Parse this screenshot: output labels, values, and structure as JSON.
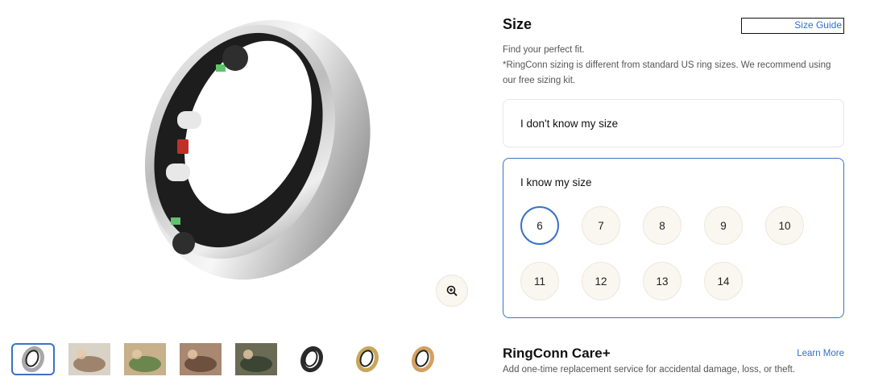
{
  "gallery": {
    "main_image": "silver smart ring product photo",
    "zoom_icon": "zoom-in-icon",
    "thumbnails": [
      {
        "name": "thumb-silver-ring",
        "kind": "ring",
        "color": "#a8a8a8",
        "selected": true
      },
      {
        "name": "thumb-hand-photo",
        "kind": "photo",
        "selected": false
      },
      {
        "name": "thumb-plant-photo",
        "kind": "photo",
        "selected": false
      },
      {
        "name": "thumb-hands-photo",
        "kind": "photo",
        "selected": false
      },
      {
        "name": "thumb-outdoor-photo",
        "kind": "photo",
        "selected": false
      },
      {
        "name": "thumb-black-ring",
        "kind": "ring",
        "color": "#2a2a2a",
        "selected": false
      },
      {
        "name": "thumb-gold-ring",
        "kind": "ring",
        "color": "#c8a75a",
        "selected": false
      },
      {
        "name": "thumb-rose-gold-ring",
        "kind": "ring",
        "color": "#d2a062",
        "selected": false
      }
    ]
  },
  "size": {
    "title": "Size",
    "guide_label": "Size Guide",
    "desc_line1": "Find your perfect fit.",
    "desc_line2": "*RingConn sizing is different from standard US ring sizes. We recommend using our free sizing kit.",
    "option_unknown": "I don't know my size",
    "option_known": "I know my size",
    "sizes": [
      "6",
      "7",
      "8",
      "9",
      "10",
      "11",
      "12",
      "13",
      "14"
    ],
    "selected_size": "6"
  },
  "care": {
    "title": "RingConn Care+",
    "learn_more": "Learn More",
    "desc": "Add one-time replacement service for accidental damage, loss, or theft."
  },
  "colors": {
    "accent": "#3a72c4",
    "link": "#2f6fd1",
    "chip_bg": "#faf6f0"
  }
}
